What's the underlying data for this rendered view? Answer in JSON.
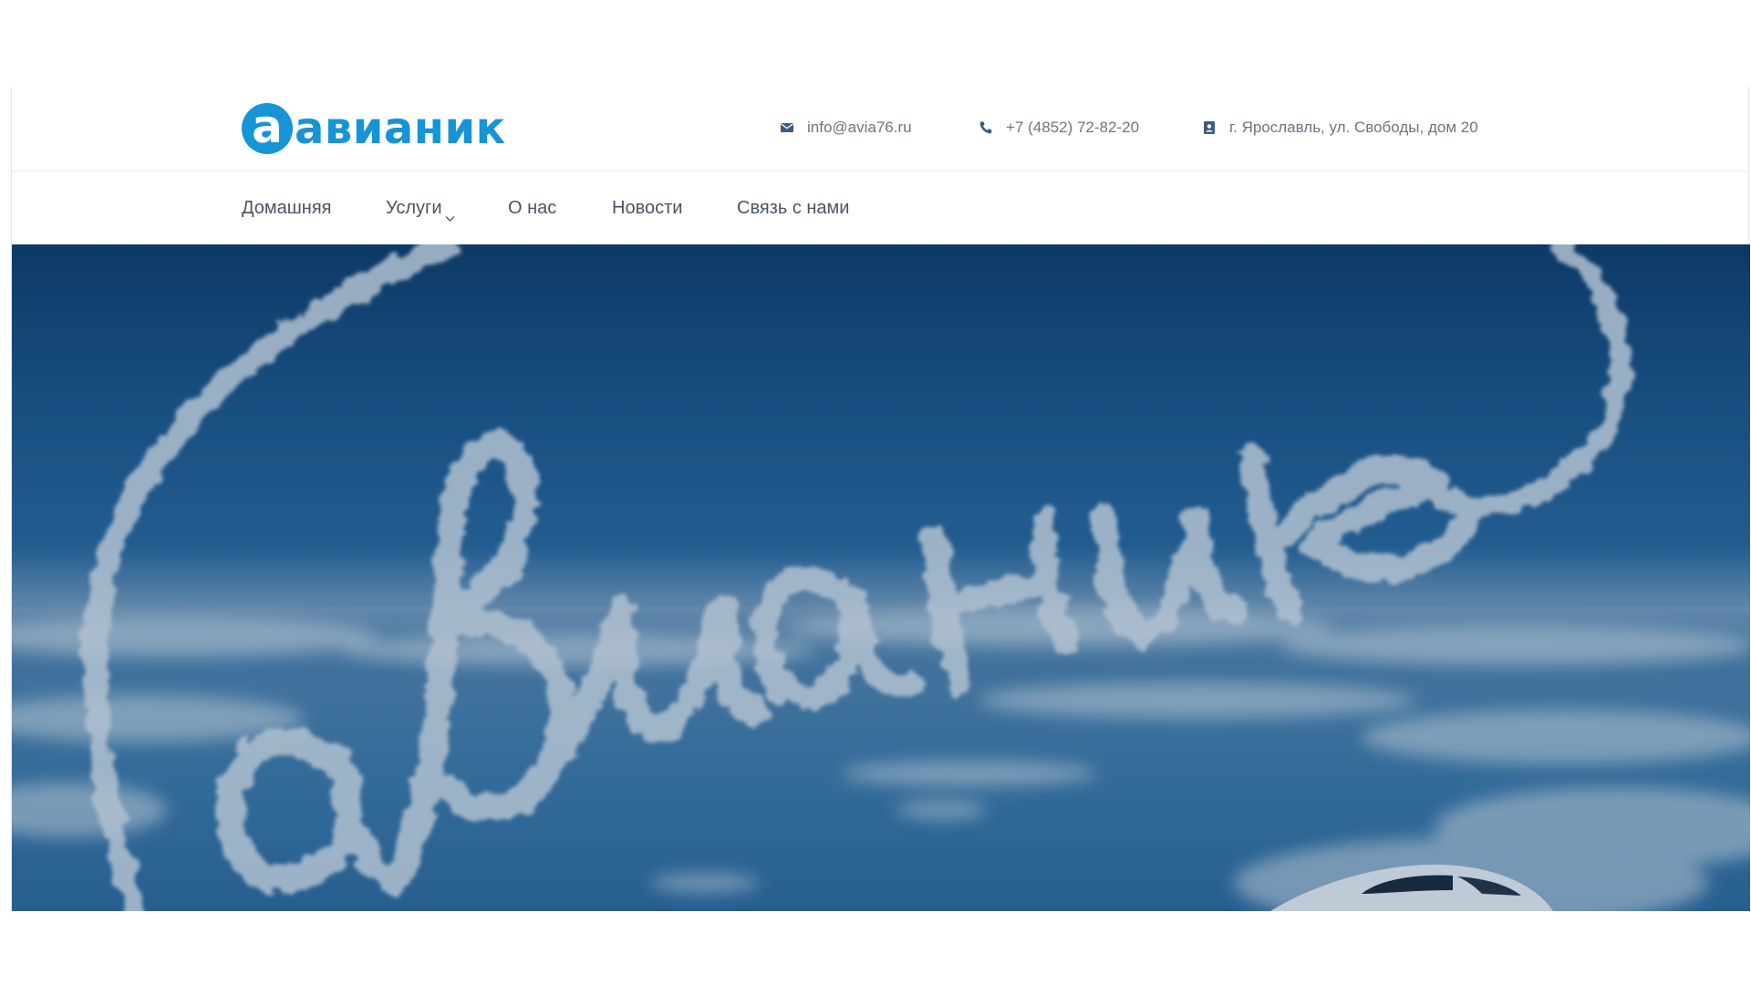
{
  "header": {
    "logo": {
      "text": "авианик",
      "color": "#1794d6"
    },
    "contacts": {
      "email": {
        "icon": "envelope-icon",
        "text": "info@avia76.ru"
      },
      "phone": {
        "icon": "phone-icon",
        "text": "+7 (4852) 72-82-20"
      },
      "address": {
        "icon": "map-pin-icon",
        "text": "г. Ярославль, ул. Свободы, дом 20"
      }
    }
  },
  "nav": {
    "items": [
      {
        "label": "Домашняя"
      },
      {
        "label": "Услуги",
        "icon": "chevron-down-icon"
      },
      {
        "label": "О нас"
      },
      {
        "label": "Новости"
      },
      {
        "label": "Связь с нами"
      }
    ]
  },
  "hero": {
    "skywriting_text": "авианик",
    "colors": {
      "sky_top": "#0d3d6b",
      "sky_mid": "#2a6aa0",
      "cloud": "#d8e4ee"
    }
  }
}
